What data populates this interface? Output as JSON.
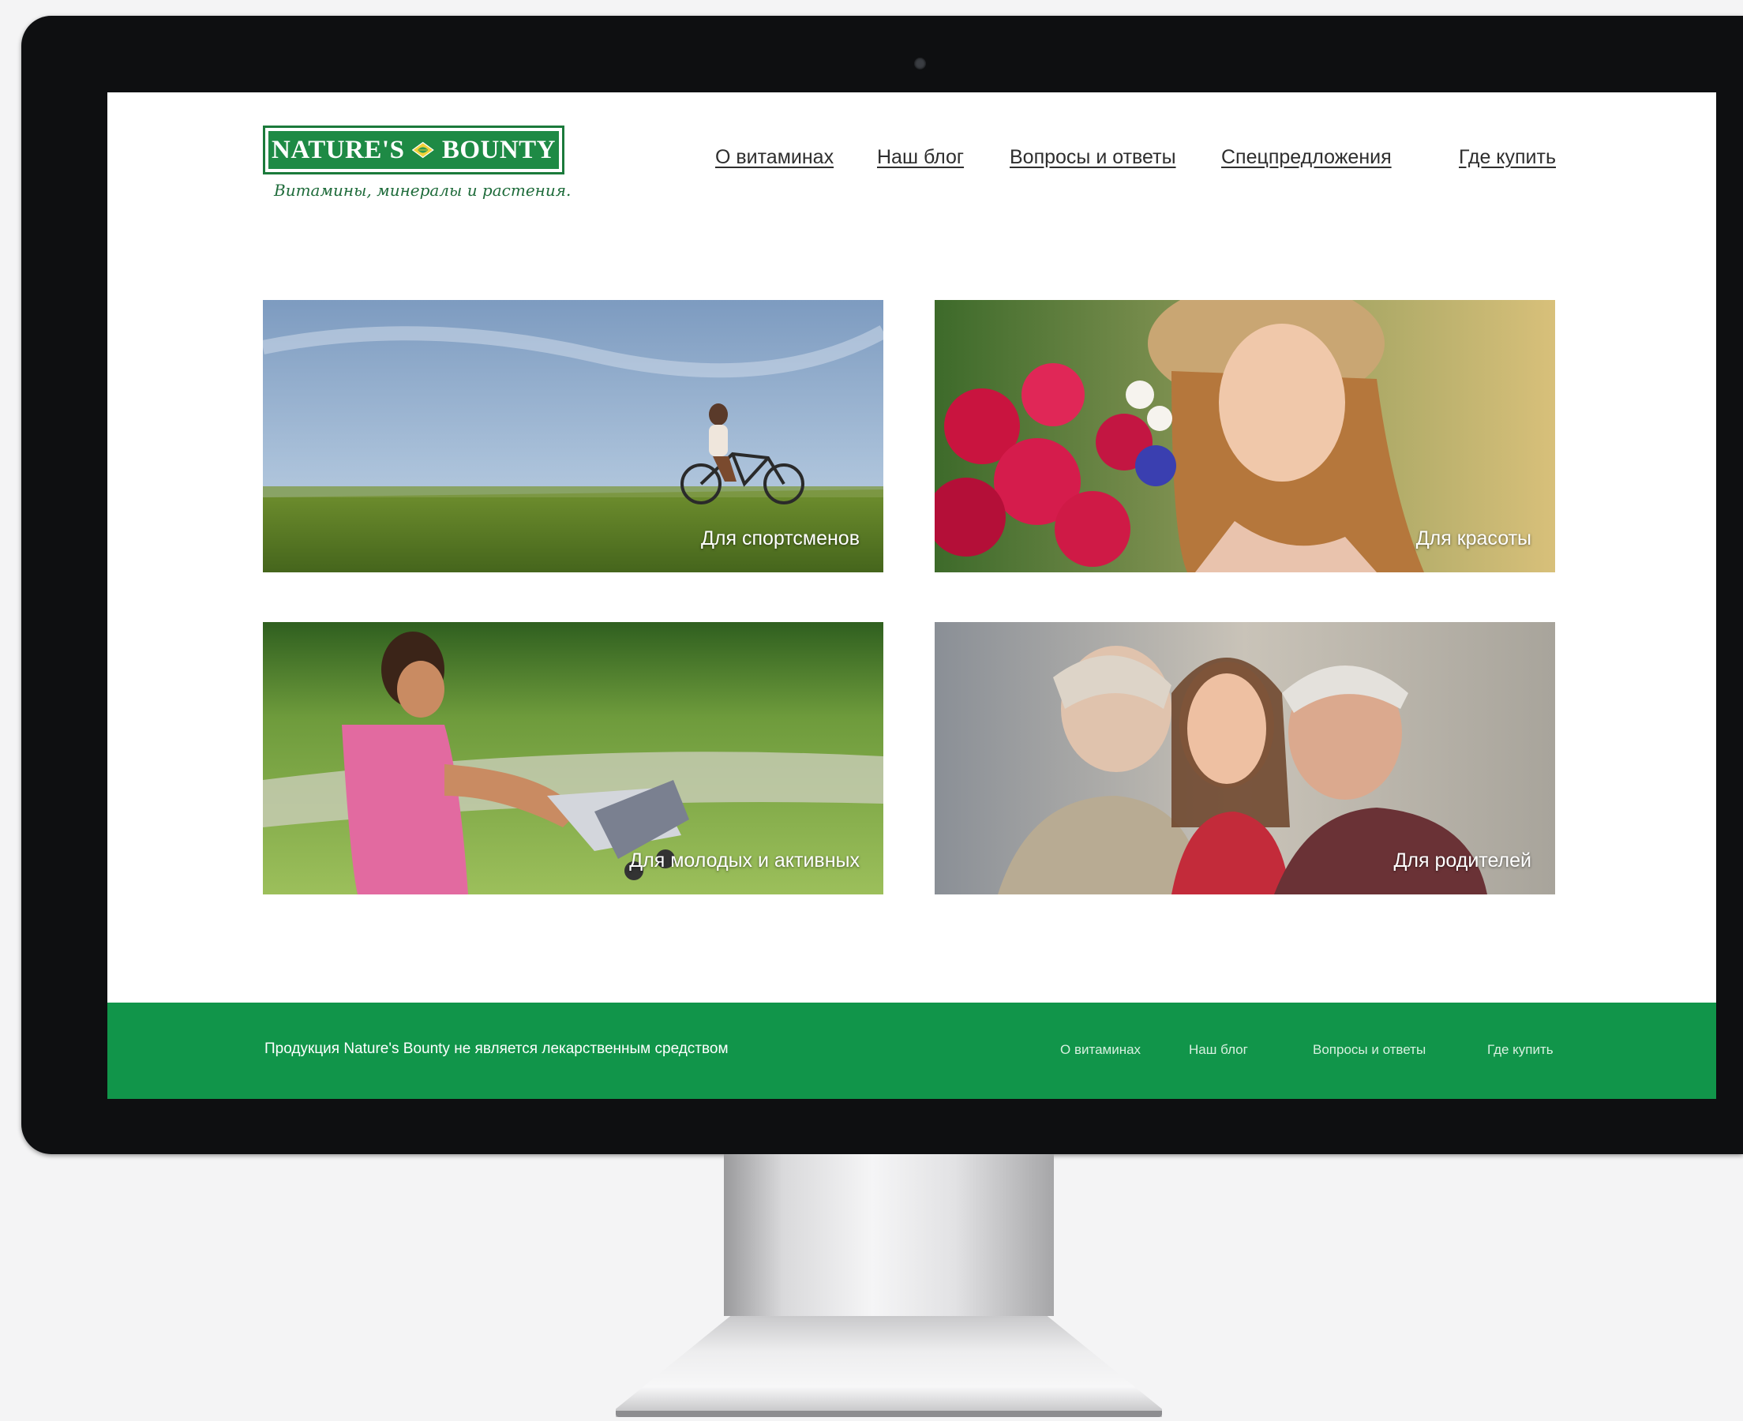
{
  "brand": {
    "name_left": "NATURE'S",
    "name_right": "BOUNTY",
    "tagline": "Витамины, минералы и растения."
  },
  "nav": {
    "items": [
      {
        "label": "О витаминах"
      },
      {
        "label": "Наш блог"
      },
      {
        "label": "Вопросы и ответы"
      },
      {
        "label": "Спецпредложения"
      },
      {
        "label": "Где купить"
      }
    ]
  },
  "tiles": [
    {
      "label": "Для спортсменов"
    },
    {
      "label": "Для красоты"
    },
    {
      "label": "Для молодых и активных"
    },
    {
      "label": "Для родителей"
    }
  ],
  "footer": {
    "note": "Продукция Nature's Bounty не является лекарственным средством",
    "links": [
      {
        "label": "О витаминах"
      },
      {
        "label": "Наш блог"
      },
      {
        "label": "Вопросы и ответы"
      },
      {
        "label": "Где купить"
      }
    ]
  },
  "colors": {
    "brand_green": "#11954a",
    "logo_green": "#1e8a45"
  }
}
